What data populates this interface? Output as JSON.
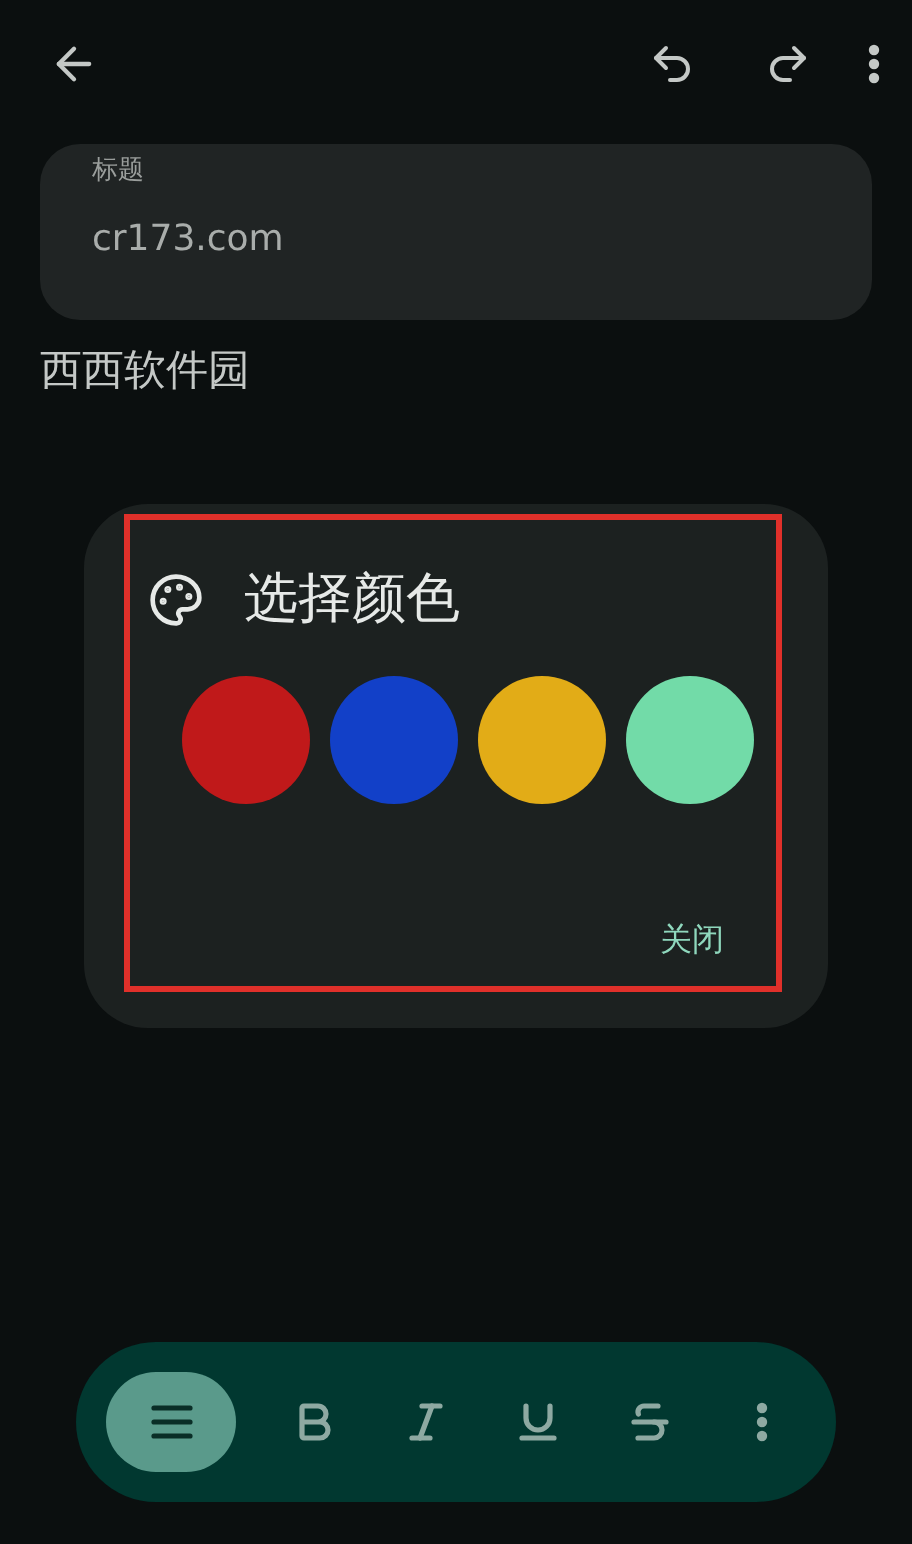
{
  "title_field": {
    "label": "标题",
    "value": "cr173.com"
  },
  "body": "西西软件园",
  "dialog": {
    "title": "选择颜色",
    "colors": [
      {
        "color": "#c0191a"
      },
      {
        "color": "#1240c8"
      },
      {
        "color": "#e2ac17"
      },
      {
        "color": "#72dba8"
      }
    ],
    "close": "关闭"
  },
  "toolbar": [
    {
      "kind": "align",
      "selected": true
    },
    {
      "kind": "bold",
      "selected": false
    },
    {
      "kind": "italic",
      "selected": false
    },
    {
      "kind": "underline",
      "selected": false
    },
    {
      "kind": "strike",
      "selected": false
    },
    {
      "kind": "more",
      "selected": false
    }
  ]
}
